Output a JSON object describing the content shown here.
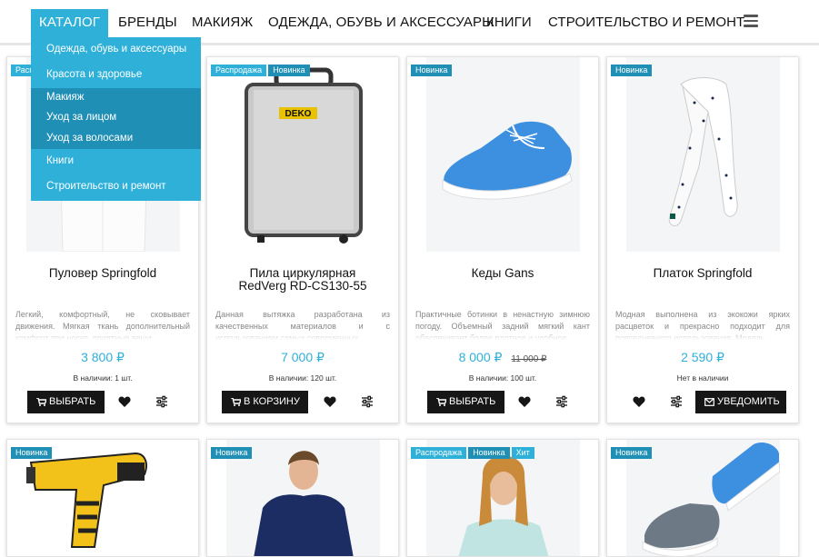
{
  "nav": {
    "items": [
      "КАТАЛОГ",
      "БРЕНДЫ",
      "МАКИЯЖ",
      "ОДЕЖДА, ОБУВЬ И АКСЕССУАРЫ",
      "КНИГИ",
      "СТРОИТЕЛЬСТВО И РЕМОНТ"
    ],
    "menu_icon": "hamburger-icon"
  },
  "dropdown": {
    "items": [
      "Одежда, обувь и аксессуары",
      "Красота и здоровье",
      "Макияж",
      "Уход за лицом",
      "Уход за волосами",
      "Книги",
      "Строительство и ремонт"
    ]
  },
  "colors": {
    "accent": "#2eb0d9",
    "accent_dark": "#1f8fb5",
    "button": "#161616"
  },
  "products": [
    {
      "badges": [
        "Распродажа"
      ],
      "title": "Пуловер Springfold",
      "desc": "Легкий, комфортный, не сковывает движения. Мягкая ткань дополнительный комфорт при носке, приятные вещи",
      "price": "3 800 ₽",
      "stock": "В наличии: 1 шт.",
      "button": "ВЫБРАТЬ"
    },
    {
      "badges": [
        "Распродажа",
        "Новинка"
      ],
      "title": "Пила циркулярная RedVerg RD-CS130-55",
      "desc": "Данная вытяжка разработана из качественных материалов и с использованием самых современных",
      "price": "7 000 ₽",
      "stock": "В наличии: 120 шт.",
      "button": "В КОРЗИНУ",
      "logo_text": "DEKO"
    },
    {
      "badges": [
        "Новинка"
      ],
      "title": "Кеды Gans",
      "desc": "Практичные ботинки в ненастную зимнюю погоду. Объемный задний мягкий кант обеспечивает более плотное и удобное",
      "price": "8 000 ₽",
      "old_price": "11 000 ₽",
      "stock": "В наличии: 100 шт.",
      "button": "ВЫБРАТЬ"
    },
    {
      "badges": [
        "Новинка"
      ],
      "title": "Платок Springfold",
      "desc": "Модная выполнена из экокожи ярких расцветок и прекрасно подходит для повседневного использования. Модель",
      "price": "2 590 ₽",
      "stock": "Нет в наличии",
      "button": "УВЕДОМИТЬ"
    },
    {
      "badges": [
        "Новинка"
      ]
    },
    {
      "badges": [
        "Новинка"
      ]
    },
    {
      "badges": [
        "Распродажа",
        "Новинка",
        "Хит"
      ]
    },
    {
      "badges": [
        "Новинка"
      ]
    }
  ]
}
